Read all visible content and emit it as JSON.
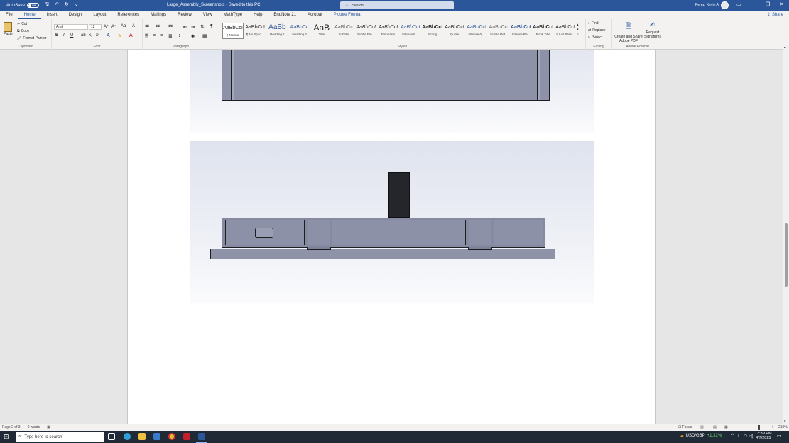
{
  "titlebar": {
    "autosave_label": "AutoSave",
    "autosave_state": "Off",
    "doc_title": "Large_Assembly_Screenshots  ·  Saved to this PC",
    "search_placeholder": "Search",
    "user_name": "Perez, Kevin A"
  },
  "tabs": [
    "File",
    "Home",
    "Insert",
    "Design",
    "Layout",
    "References",
    "Mailings",
    "Review",
    "View",
    "MathType",
    "Help",
    "EndNote 21",
    "Acrobat",
    "Picture Format"
  ],
  "share_label": "Share",
  "ribbon": {
    "clipboard": {
      "paste": "Paste",
      "cut": "Cut",
      "copy": "Copy",
      "format_painter": "Format Painter",
      "label": "Clipboard"
    },
    "font": {
      "name": "Arial",
      "size": "12",
      "label": "Font"
    },
    "paragraph": {
      "label": "Paragraph"
    },
    "styles": {
      "label": "Styles",
      "items": [
        {
          "sample": "AaBbCcI",
          "name": "¶ Normal"
        },
        {
          "sample": "AaBbCcI",
          "name": "¶ No Spac..."
        },
        {
          "sample": "AaBb",
          "name": "Heading 1"
        },
        {
          "sample": "AaBbCc",
          "name": "Heading 2"
        },
        {
          "sample": "AaB",
          "name": "Title"
        },
        {
          "sample": "AaBbCc",
          "name": "Subtitle"
        },
        {
          "sample": "AaBbCcI",
          "name": "Subtle Em..."
        },
        {
          "sample": "AaBbCcI",
          "name": "Emphasis"
        },
        {
          "sample": "AaBbCcI",
          "name": "Intense E..."
        },
        {
          "sample": "AaBbCcI",
          "name": "Strong"
        },
        {
          "sample": "AaBbCcI",
          "name": "Quote"
        },
        {
          "sample": "AaBbCcI",
          "name": "Intense Q..."
        },
        {
          "sample": "AaBbCcI",
          "name": "Subtle Ref..."
        },
        {
          "sample": "AaBbCcI",
          "name": "Intense Re..."
        },
        {
          "sample": "AaBbCcI",
          "name": "Book Title"
        },
        {
          "sample": "AaBbCcI",
          "name": "¶ List Para..."
        }
      ]
    },
    "editing": {
      "find": "Find",
      "replace": "Replace",
      "select": "Select",
      "label": "Editing"
    },
    "acrobat": {
      "create_share": "Create and Share Adobe PDF",
      "request_sig": "Request Signatures",
      "label": "Adobe Acrobat"
    }
  },
  "status": {
    "page": "Page 2 of 3",
    "words": "0 words",
    "focus": "Focus",
    "zoom": "210%"
  },
  "taskbar": {
    "search_placeholder": "Type here to search",
    "ticker": "USD/GBP",
    "ticker_change": "+1.32%",
    "time": "12:39 PM",
    "date": "4/7/2025"
  },
  "colors": {
    "title_bar": "#2b579a",
    "taskbar": "#202a36",
    "part_fill": "#8f93a8"
  }
}
